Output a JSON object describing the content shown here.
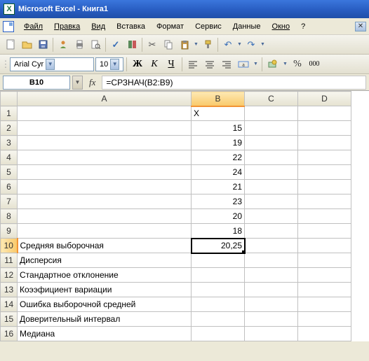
{
  "title": "Microsoft Excel - Книга1",
  "menu": {
    "file": "Файл",
    "edit": "Правка",
    "view": "Вид",
    "insert": "Вставка",
    "format": "Формат",
    "tools": "Сервис",
    "data": "Данные",
    "window": "Окно",
    "help": "?"
  },
  "font": {
    "name": "Arial Cyr",
    "size": "10",
    "bold_label": "Ж",
    "italic_label": "К",
    "underline_label": "Ч"
  },
  "formula": {
    "namebox": "B10",
    "fx": "fx",
    "value": "=СРЗНАЧ(B2:B9)"
  },
  "columns": [
    "A",
    "B",
    "C",
    "D"
  ],
  "rows": [
    {
      "n": "1",
      "a": "",
      "b": "X",
      "c": "",
      "d": ""
    },
    {
      "n": "2",
      "a": "",
      "b": "15",
      "c": "",
      "d": ""
    },
    {
      "n": "3",
      "a": "",
      "b": "19",
      "c": "",
      "d": ""
    },
    {
      "n": "4",
      "a": "",
      "b": "22",
      "c": "",
      "d": ""
    },
    {
      "n": "5",
      "a": "",
      "b": "24",
      "c": "",
      "d": ""
    },
    {
      "n": "6",
      "a": "",
      "b": "21",
      "c": "",
      "d": ""
    },
    {
      "n": "7",
      "a": "",
      "b": "23",
      "c": "",
      "d": ""
    },
    {
      "n": "8",
      "a": "",
      "b": "20",
      "c": "",
      "d": ""
    },
    {
      "n": "9",
      "a": "",
      "b": "18",
      "c": "",
      "d": ""
    },
    {
      "n": "10",
      "a": "Средняя выборочная",
      "b": "20,25",
      "c": "",
      "d": ""
    },
    {
      "n": "11",
      "a": "Дисперсия",
      "b": "",
      "c": "",
      "d": ""
    },
    {
      "n": "12",
      "a": "Стандартное отклонение",
      "b": "",
      "c": "",
      "d": ""
    },
    {
      "n": "13",
      "a": "Коээфициент вариации",
      "b": "",
      "c": "",
      "d": ""
    },
    {
      "n": "14",
      "a": "Ошибка выборочной средней",
      "b": "",
      "c": "",
      "d": ""
    },
    {
      "n": "15",
      "a": "Доверительный интервал",
      "b": "",
      "c": "",
      "d": ""
    },
    {
      "n": "16",
      "a": "Медиана",
      "b": "",
      "c": "",
      "d": ""
    }
  ],
  "active_cell": "B10"
}
